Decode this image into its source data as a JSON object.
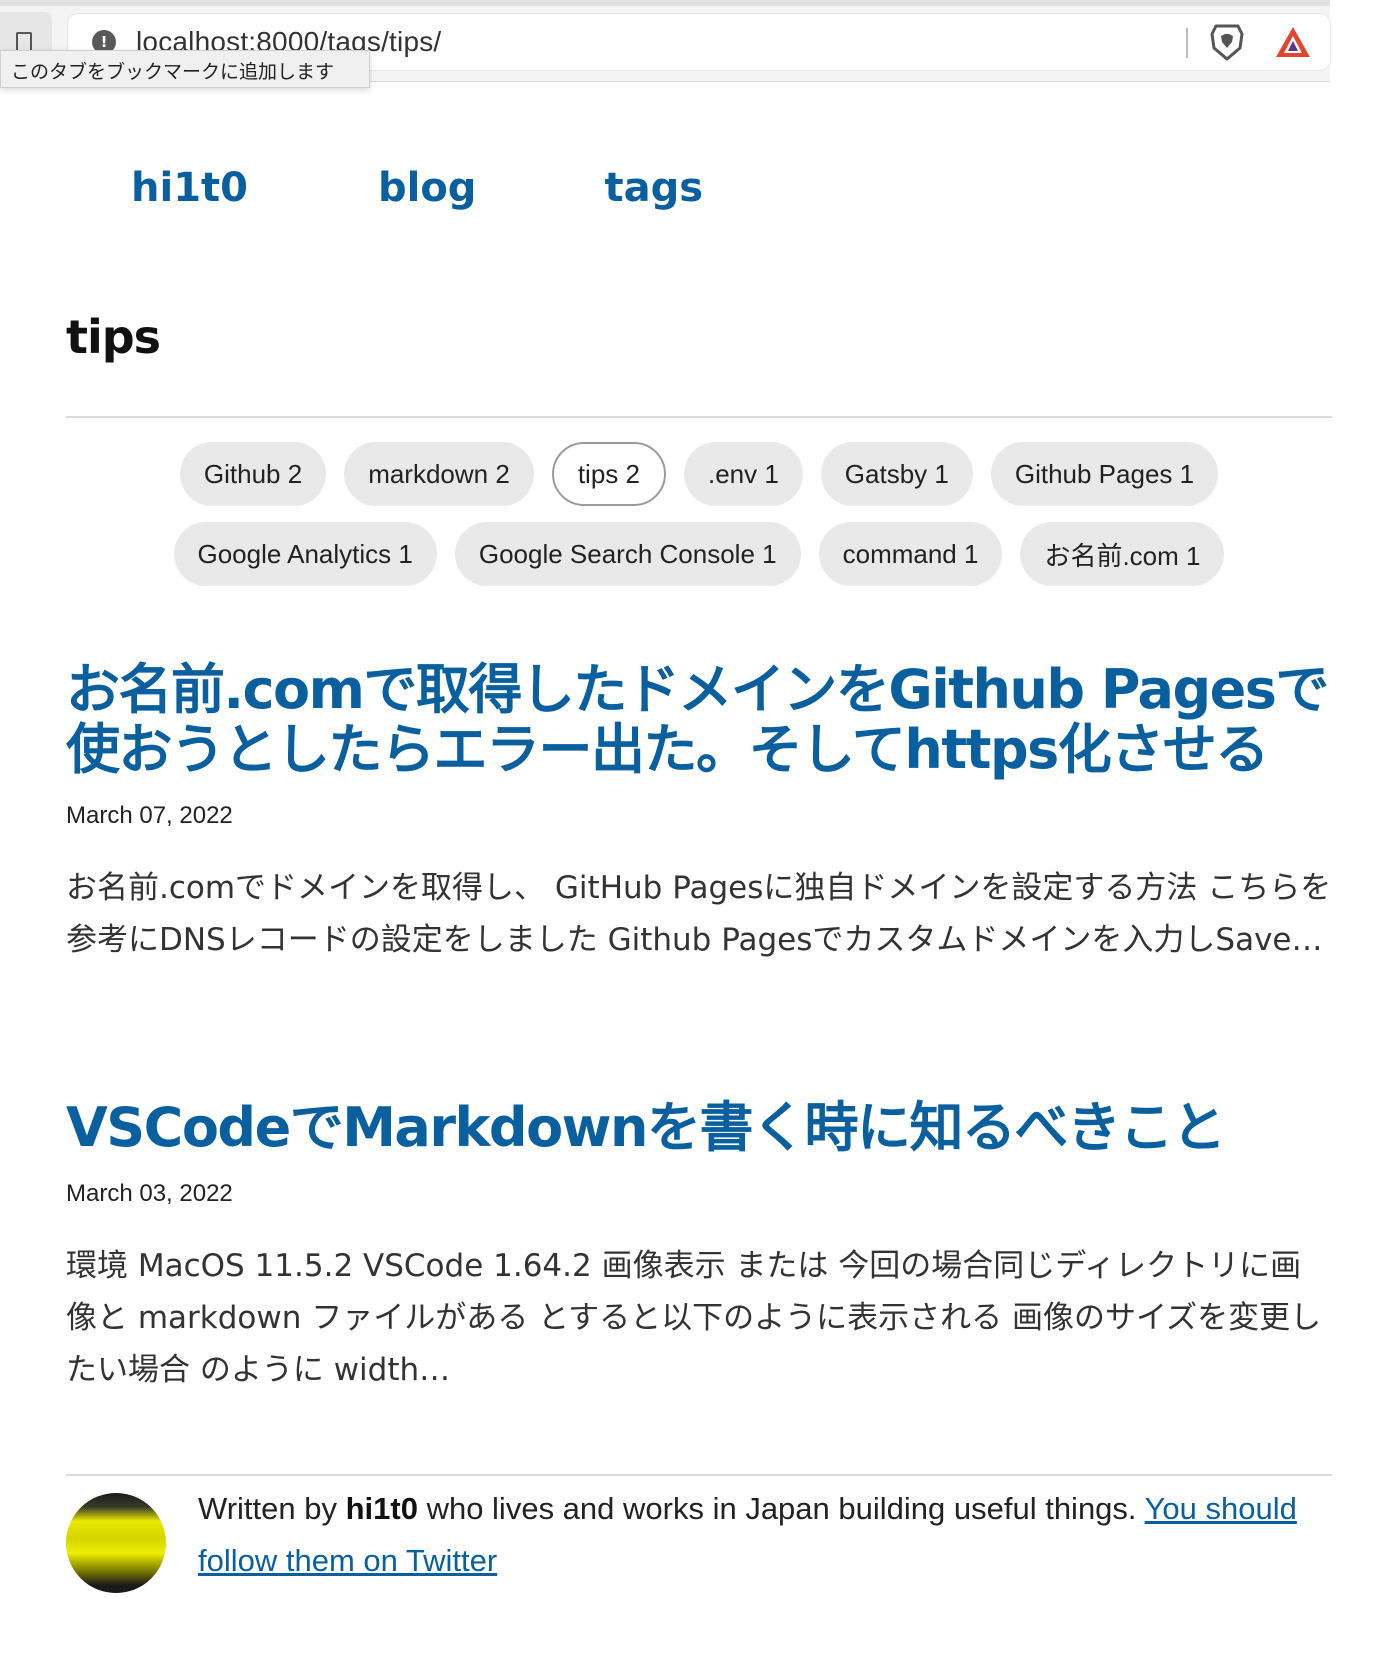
{
  "browser": {
    "url": "localhost:8000/tags/tips/",
    "tooltip": "このタブをブックマークに追加します"
  },
  "nav": {
    "home": "hi1t0",
    "blog": "blog",
    "tags": "tags"
  },
  "page": {
    "title": "tips"
  },
  "tags": [
    {
      "label": "Github 2",
      "active": false
    },
    {
      "label": "markdown 2",
      "active": false
    },
    {
      "label": "tips 2",
      "active": true
    },
    {
      "label": ".env 1",
      "active": false
    },
    {
      "label": "Gatsby 1",
      "active": false
    },
    {
      "label": "Github Pages 1",
      "active": false
    },
    {
      "label": "Google Analytics 1",
      "active": false
    },
    {
      "label": "Google Search Console 1",
      "active": false
    },
    {
      "label": "command 1",
      "active": false
    },
    {
      "label": "お名前.com 1",
      "active": false
    }
  ],
  "posts": [
    {
      "title": "お名前.comで取得したドメインをGithub Pagesで使おうとしたらエラー出た。そしてhttps化させる",
      "date": "March 07, 2022",
      "excerpt": "お名前.comでドメインを取得し、 GitHub Pagesに独自ドメインを設定する方法 こちらを参考にDNSレコードの設定をしました Github Pagesでカスタムドメインを入力しSave…"
    },
    {
      "title": "VSCodeでMarkdownを書く時に知るべきこと",
      "date": "March 03, 2022",
      "excerpt": "環境 MacOS 11.5.2 VSCode 1.64.2 画像表示 または 今回の場合同じディレクトリに画像と markdown ファイルがある とすると以下のように表示される 画像のサイズを変更したい場合 のように width…"
    }
  ],
  "bio": {
    "prefix": "Written by ",
    "author": "hi1t0",
    "suffix": " who lives and works in Japan building useful things. ",
    "link": "You should follow them on Twitter"
  },
  "colors": {
    "link": "#0a5f9e",
    "pill_bg": "#e9e9e9"
  }
}
